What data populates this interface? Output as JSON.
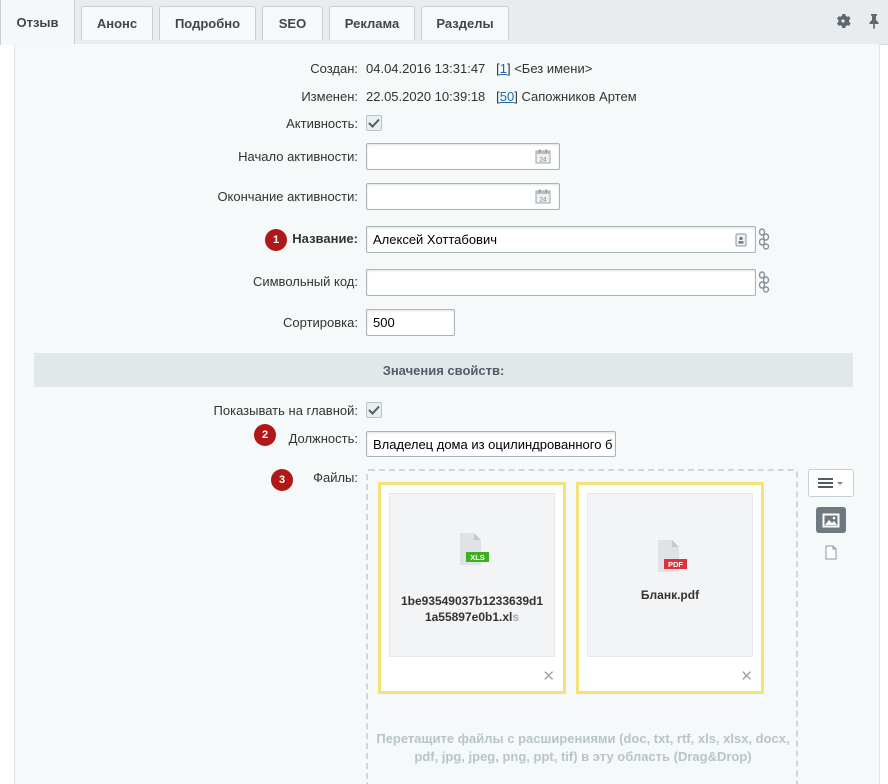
{
  "tabs": [
    {
      "label": "Отзыв",
      "active": true
    },
    {
      "label": "Анонс"
    },
    {
      "label": "Подробно"
    },
    {
      "label": "SEO"
    },
    {
      "label": "Реклама"
    },
    {
      "label": "Разделы"
    }
  ],
  "meta": {
    "created_label": "Создан:",
    "created_value": "04.04.2016 13:31:47",
    "created_user_id": "1",
    "created_user_name": "<Без имени>",
    "modified_label": "Изменен:",
    "modified_value": "22.05.2020 10:39:18",
    "modified_user_id": "50",
    "modified_user_name": "Сапожников Артем"
  },
  "fields": {
    "active_label": "Активность:",
    "active_from_label": "Начало активности:",
    "active_from_value": "",
    "active_to_label": "Окончание активности:",
    "active_to_value": "",
    "name_label": "Название:",
    "name_value": "Алексей Хоттабович",
    "code_label": "Символьный код:",
    "code_value": "",
    "sort_label": "Сортировка:",
    "sort_value": "500"
  },
  "properties": {
    "section_title": "Значения свойств:",
    "show_on_main_label": "Показывать на главной:",
    "position_label": "Должность:",
    "position_value": "Владелец дома из оцилиндрованного б",
    "files_label": "Файлы:"
  },
  "badges": {
    "one": "1",
    "two": "2",
    "three": "3"
  },
  "files": [
    {
      "name_main": "1be93549037b1233639d1",
      "name_line2": "1a55897e0b1.xl",
      "name_ext": "s",
      "type": "XLS",
      "type_color": "#3db020"
    },
    {
      "name_main": "Бланк.pdf",
      "type": "PDF",
      "type_color": "#e0313a"
    }
  ],
  "file_remove_glyph": "✕",
  "drop_hint": "Перетащите файлы с расширениями (doc, txt, rtf, xls, xlsx, docx, pdf, jpg, jpeg, png, ppt, tif) в эту область (Drag&Drop)",
  "colors": {
    "badge": "#b01818",
    "card_border": "#f5e37a",
    "link": "#2067b0"
  }
}
